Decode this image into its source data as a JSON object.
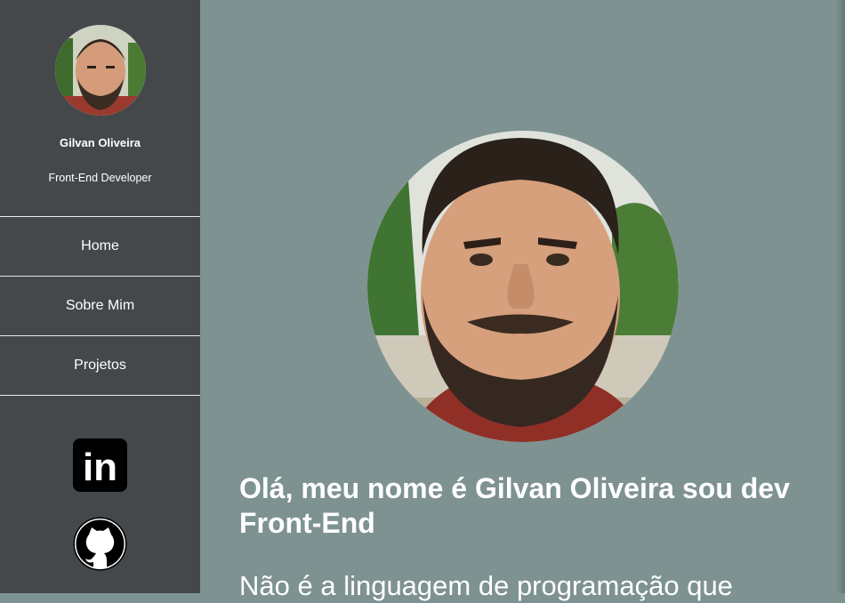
{
  "sidebar": {
    "profile": {
      "name": "Gilvan Oliveira",
      "role": "Front-End Developer"
    },
    "nav": [
      {
        "label": "Home"
      },
      {
        "label": "Sobre Mim"
      },
      {
        "label": "Projetos"
      }
    ],
    "social": [
      {
        "icon": "linkedin-icon",
        "text": "in"
      },
      {
        "icon": "github-icon"
      }
    ]
  },
  "main": {
    "headline": "Olá, meu nome é Gilvan Oliveira sou dev Front-End",
    "intro": "Não é a linguagem de programação que"
  },
  "colors": {
    "sidebar_bg": "#44484b",
    "main_bg": "#7e9292",
    "text": "#ffffff"
  }
}
